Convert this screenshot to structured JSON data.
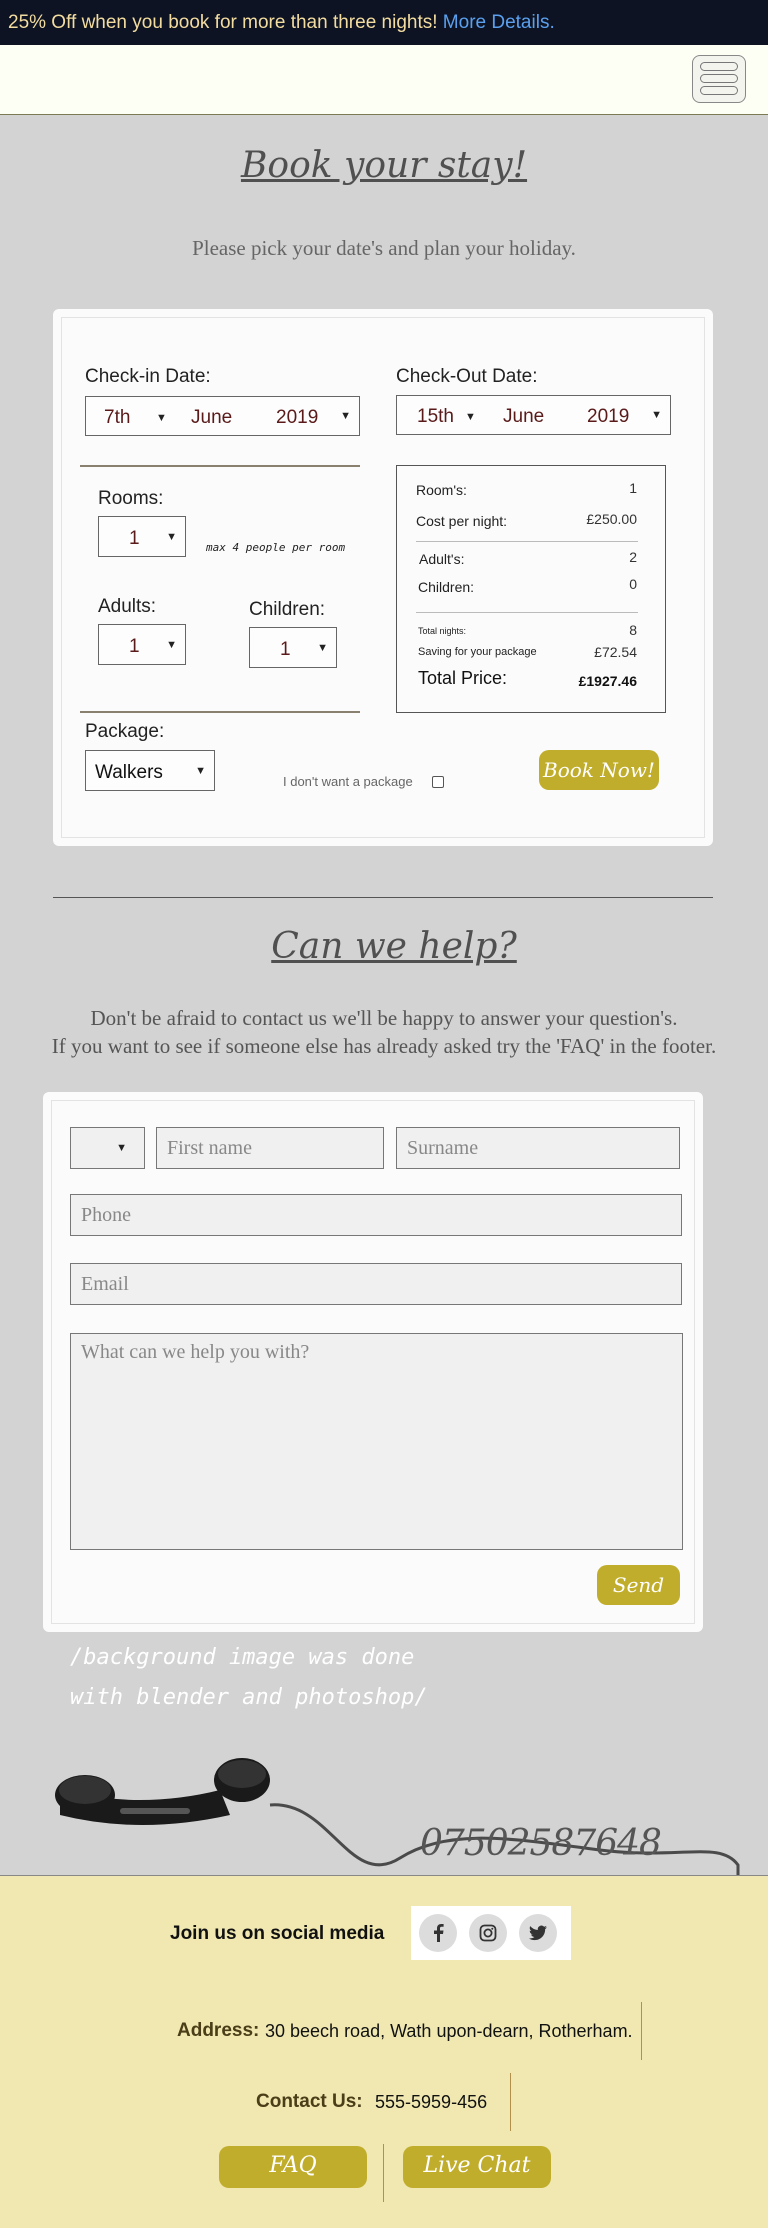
{
  "promo": {
    "text": "25% Off when you book for more than three nights!",
    "link": "More Details."
  },
  "booking": {
    "title": "Book your stay!",
    "subtitle": "Please pick your date's and plan your holiday.",
    "checkin_label": "Check-in Date:",
    "checkin": {
      "day": "7th",
      "month": "June",
      "year": "2019"
    },
    "checkout_label": "Check-Out Date:",
    "checkout": {
      "day": "15th",
      "month": "June",
      "year": "2019"
    },
    "rooms_label": "Rooms:",
    "rooms": "1",
    "rooms_note": "max 4 people per room",
    "adults_label": "Adults:",
    "adults": "1",
    "children_label": "Children:",
    "children": "1",
    "package_label": "Package:",
    "package": "Walkers",
    "no_package_label": "I don't want a package",
    "book_button": "Book Now!",
    "summary": {
      "rooms_label": "Room's:",
      "rooms": "1",
      "cost_label": "Cost per night:",
      "cost": "£250.00",
      "adults_label": "Adult's:",
      "adults": "2",
      "children_label": "Children:",
      "children": "0",
      "nights_label": "Total nights:",
      "nights": "8",
      "saving_label": "Saving for your package",
      "saving": "£72.54",
      "total_label": "Total Price:",
      "total": "£1927.46"
    }
  },
  "help": {
    "title": "Can we help?",
    "line1": "Don't be afraid to contact us we'll be happy to answer your question's.",
    "line2": "If you want to see if someone else has already asked try the 'FAQ' in the footer.",
    "title_select": "",
    "first_name_placeholder": "First name",
    "surname_placeholder": "Surname",
    "phone_placeholder": "Phone",
    "email_placeholder": "Email",
    "message_placeholder": "What can we help you with?",
    "send_button": "Send"
  },
  "background_note": "/background image was done with blender and photoshop/",
  "phone_number": "07502587648",
  "footer": {
    "social_label": "Join us on social media",
    "social_icons": [
      "facebook-icon",
      "instagram-icon",
      "twitter-icon"
    ],
    "address_label": "Address:",
    "address": "30 beech road, Wath upon-dearn, Rotherham.",
    "contact_label": "Contact Us:",
    "contact": "555-5959-456",
    "faq_button": "FAQ",
    "chat_button": "Live Chat"
  },
  "colors": {
    "accent": "#c1ad2c",
    "banner": "#0d1322",
    "footer": "#f0e8b0",
    "link": "#5aa0ef"
  }
}
